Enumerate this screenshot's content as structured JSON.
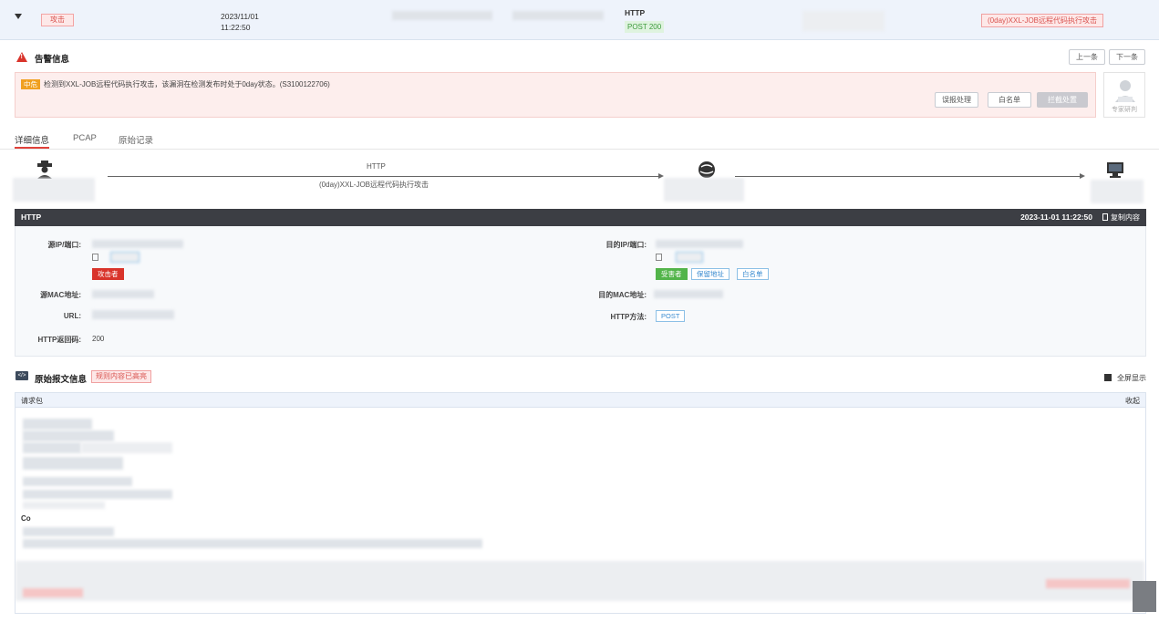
{
  "event_row": {
    "type_tag": "攻击",
    "date": "2023/11/01",
    "time": "11:22:50",
    "protocol": "HTTP",
    "method_status": "POST  200",
    "rule_tag": "(0day)XXL-JOB远程代码执行攻击"
  },
  "alert": {
    "title": "告警信息",
    "prev_label": "上一条",
    "next_label": "下一条",
    "severity": "中危",
    "message": "检测到XXL-JOB远程代码执行攻击，该漏洞在检测发布时处于0day状态。(S3100122706)",
    "false_positive_label": "误报处理",
    "whitelist_label": "白名单",
    "block_label": "拦截处置",
    "expert_label": "专家研判"
  },
  "tabs": [
    {
      "label": "详细信息",
      "active": true
    },
    {
      "label": "PCAP",
      "active": false
    },
    {
      "label": "原始记录",
      "active": false
    }
  ],
  "flow": {
    "protocol_label": "HTTP",
    "rule_label": "(0day)XXL-JOB远程代码执行攻击"
  },
  "http_panel": {
    "title": "HTTP",
    "timestamp": "2023-11-01 11:22:50",
    "copy_label": "复制内容",
    "src_ip_label": "源IP/端口:",
    "attacker_tag": "攻击者",
    "dst_ip_label": "目的IP/端口:",
    "victim_tag": "受害者",
    "protected_tag": "保留地址",
    "whitelist_tag": "白名单",
    "src_mac_label": "源MAC地址:",
    "dst_mac_label": "目的MAC地址:",
    "url_label": "URL:",
    "http_method_label": "HTTP方法:",
    "http_method_value": "POST",
    "status_label": "HTTP返回码:",
    "status_value": "200"
  },
  "raw_message": {
    "title": "原始报文信息",
    "highlight_tag": "规则内容已高亮",
    "fullscreen_label": "全屏显示",
    "request_label": "请求包",
    "collapse_label": "收起",
    "visible_fragment": "Co"
  },
  "colors": {
    "danger": "#d9342b",
    "warning": "#f0a020",
    "success": "#52b44a",
    "header_dark": "#3c3e44"
  }
}
